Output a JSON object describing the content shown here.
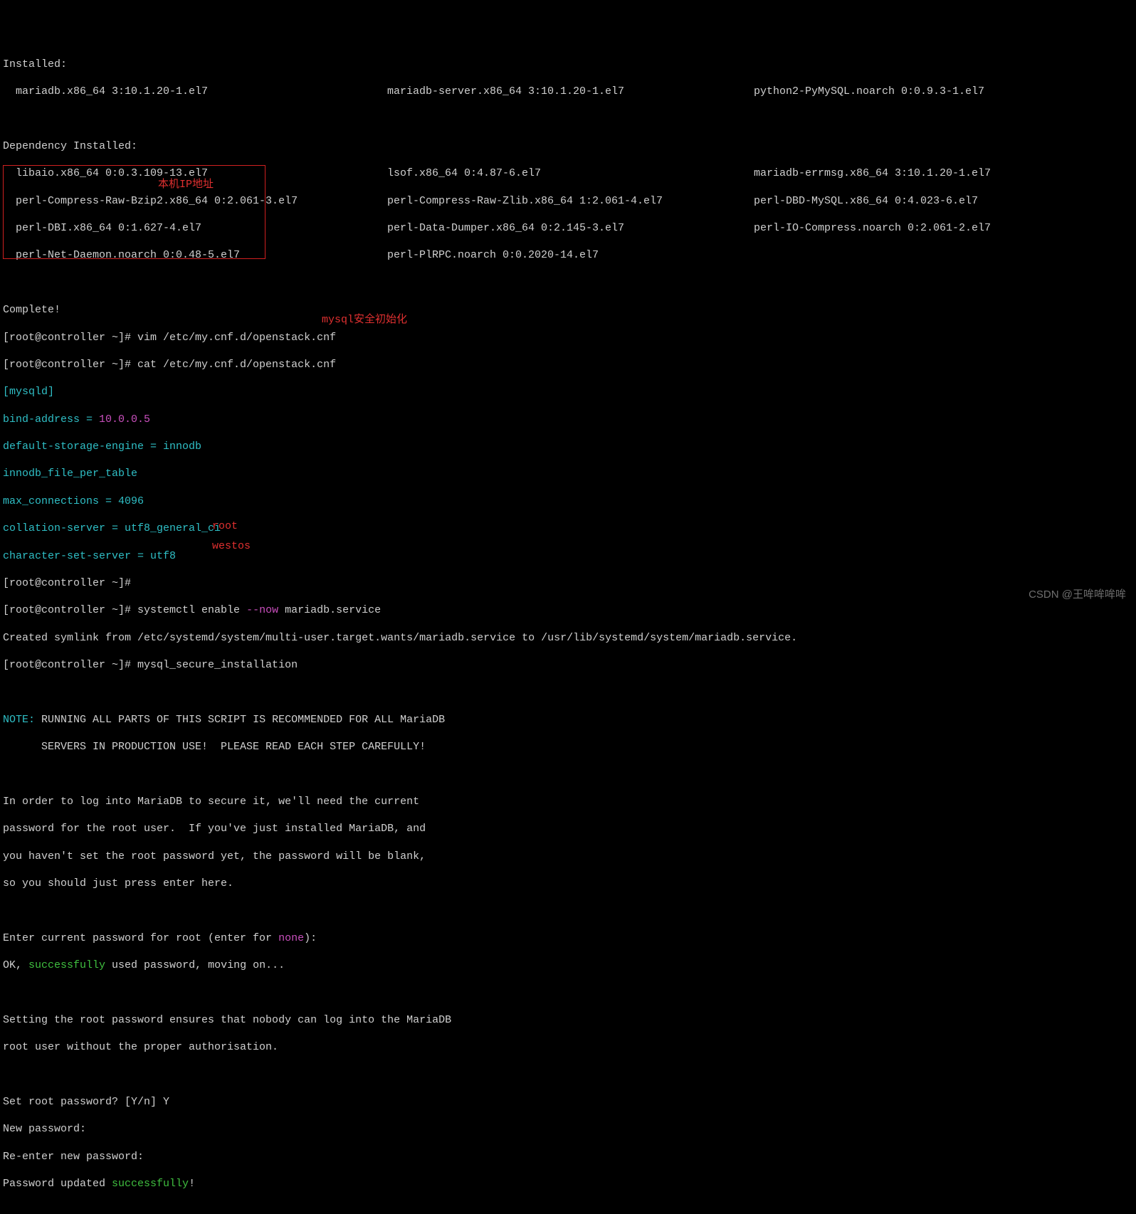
{
  "installed_header": "Installed:",
  "installed": [
    "  mariadb.x86_64 3:10.1.20-1.el7",
    "mariadb-server.x86_64 3:10.1.20-1.el7",
    "python2-PyMySQL.noarch 0:0.9.3-1.el7"
  ],
  "dep_header": "Dependency Installed:",
  "dep_rows": [
    [
      "  libaio.x86_64 0:0.3.109-13.el7",
      "lsof.x86_64 0:4.87-6.el7",
      "mariadb-errmsg.x86_64 3:10.1.20-1.el7"
    ],
    [
      "  perl-Compress-Raw-Bzip2.x86_64 0:2.061-3.el7",
      "perl-Compress-Raw-Zlib.x86_64 1:2.061-4.el7",
      "perl-DBD-MySQL.x86_64 0:4.023-6.el7"
    ],
    [
      "  perl-DBI.x86_64 0:1.627-4.el7",
      "perl-Data-Dumper.x86_64 0:2.145-3.el7",
      "perl-IO-Compress.noarch 0:2.061-2.el7"
    ],
    [
      "  perl-Net-Daemon.noarch 0:0.48-5.el7",
      "perl-PlRPC.noarch 0:0.2020-14.el7",
      ""
    ]
  ],
  "complete": "Complete!",
  "prompt": "[root@controller ~]# ",
  "cmd_vim": "vim /etc/my.cnf.d/openstack.cnf",
  "cmd_cat": "cat /etc/my.cnf.d/openstack.cnf",
  "cnf": {
    "section": "[mysqld]",
    "bind_key": "bind-address = ",
    "bind_val": "10.0.0.5",
    "l3": "default-storage-engine = innodb",
    "l4": "innodb_file_per_table",
    "l5": "max_connections = 4096",
    "l6": "collation-server = utf8_general_ci",
    "l7": "character-set-server = utf8"
  },
  "cmd_systemctl_a": "systemctl enable ",
  "cmd_systemctl_b": "--now",
  "cmd_systemctl_c": " mariadb.service",
  "symlink": "Created symlink from /etc/systemd/system/multi-user.target.wants/mariadb.service to /usr/lib/systemd/system/mariadb.service.",
  "cmd_secure": "mysql_secure_installation",
  "note_label": "NOTE:",
  "note1": " RUNNING ALL PARTS OF THIS SCRIPT IS RECOMMENDED FOR ALL MariaDB",
  "note2": "      SERVERS IN PRODUCTION USE!  PLEASE READ EACH STEP CAREFULLY!",
  "para1": [
    "In order to log into MariaDB to secure it, we'll need the current",
    "password for the root user.  If you've just installed MariaDB, and",
    "you haven't set the root password yet, the password will be blank,",
    "so you should just press enter here."
  ],
  "enter_a": "Enter current password for root (enter for ",
  "enter_b": "none",
  "enter_c": "):",
  "ok_a": "OK, ",
  "ok_b": "successfully",
  "ok_c": " used password, moving on...",
  "para2": [
    "Setting the root password ensures that nobody can log into the MariaDB",
    "root user without the proper authorisation."
  ],
  "setroot": "Set root password? [Y/n] Y",
  "newpw": "New password:",
  "repw": "Re-enter new password:",
  "pwupd_a": "Password updated ",
  "pwupd_b": "successfully",
  "pwupd_c": "!",
  "anno_ip": "本机IP地址",
  "anno_sec": "mysql安全初始化",
  "anno_root": "root",
  "anno_westos": "westos",
  "watermark": "CSDN @王哞哞哞哞"
}
